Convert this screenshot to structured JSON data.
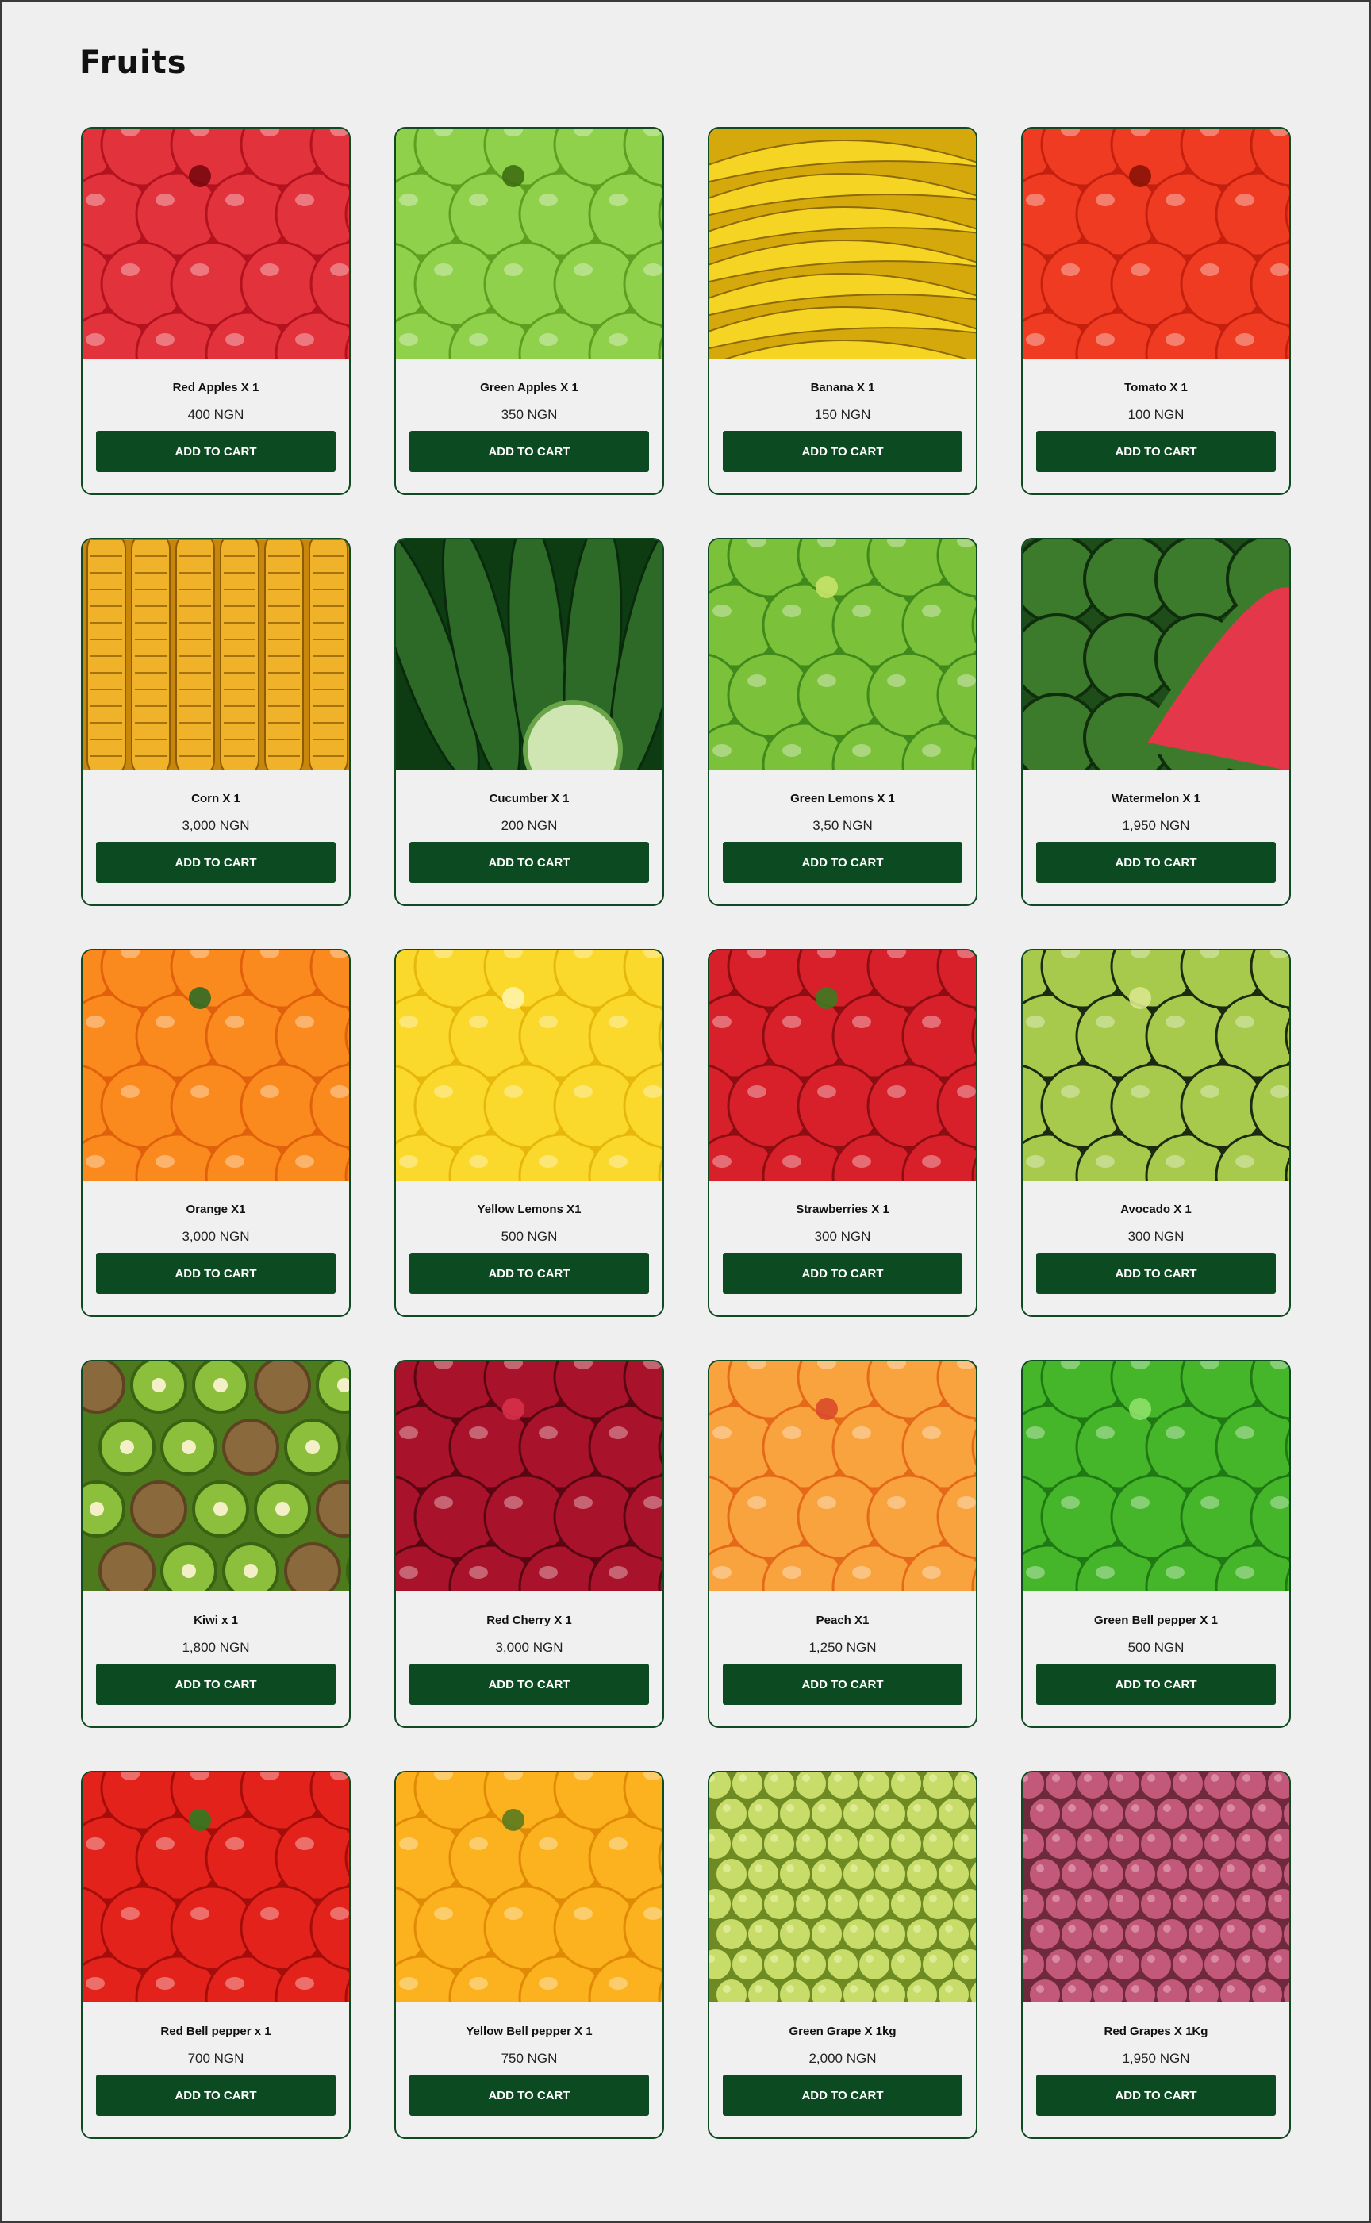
{
  "page": {
    "title": "Fruits"
  },
  "products": [
    {
      "name": "Red Apples X 1",
      "price": "400 NGN",
      "cta": "ADD TO CART",
      "icon": "red-apples-image",
      "bg": "#b3121f",
      "fg": "#e2323c",
      "accent": "#7a0810",
      "shape": "circle"
    },
    {
      "name": "Green Apples X 1",
      "price": "350 NGN",
      "cta": "ADD TO CART",
      "icon": "green-apples-image",
      "bg": "#5e9e21",
      "fg": "#8fd14a",
      "accent": "#3e6e12",
      "shape": "circle"
    },
    {
      "name": "Banana X 1",
      "price": "150 NGN",
      "cta": "ADD TO CART",
      "icon": "banana-image",
      "bg": "#d5a90c",
      "fg": "#f6d424",
      "accent": "#8c6a08",
      "shape": "banana"
    },
    {
      "name": "Tomato X 1",
      "price": "100 NGN",
      "cta": "ADD TO CART",
      "icon": "tomato-image",
      "bg": "#c5200f",
      "fg": "#ee3b22",
      "accent": "#8a1407",
      "shape": "circle"
    },
    {
      "name": "Corn X 1",
      "price": "3,000 NGN",
      "cta": "ADD TO CART",
      "icon": "corn-image",
      "bg": "#c8860b",
      "fg": "#f0b228",
      "accent": "#8e5c05",
      "shape": "corn"
    },
    {
      "name": "Cucumber X 1",
      "price": "200 NGN",
      "cta": "ADD TO CART",
      "icon": "cucumber-image",
      "bg": "#0d3b12",
      "fg": "#2d6a27",
      "accent": "#cfe6b3",
      "shape": "cucumber"
    },
    {
      "name": "Green Lemons X 1",
      "price": "3,50 NGN",
      "cta": "ADD TO CART",
      "icon": "green-lemons-image",
      "bg": "#3f8a1b",
      "fg": "#7cc13a",
      "accent": "#c8e36a",
      "shape": "circle"
    },
    {
      "name": "Watermelon X 1",
      "price": "1,950 NGN",
      "cta": "ADD TO CART",
      "icon": "watermelon-image",
      "bg": "#1f4d1a",
      "fg": "#3c7a2c",
      "accent": "#e4384a",
      "shape": "watermelon"
    },
    {
      "name": "Orange X1",
      "price": "3,000 NGN",
      "cta": "ADD TO CART",
      "icon": "orange-image",
      "bg": "#e0600c",
      "fg": "#fb8a1e",
      "accent": "#2f6a24",
      "shape": "circle"
    },
    {
      "name": "Yellow Lemons X1",
      "price": "500 NGN",
      "cta": "ADD TO CART",
      "icon": "yellow-lemons-image",
      "bg": "#e6b80c",
      "fg": "#fbd92c",
      "accent": "#fff3a8",
      "shape": "circle"
    },
    {
      "name": "Strawberries X 1",
      "price": "300 NGN",
      "cta": "ADD TO CART",
      "icon": "strawberries-image",
      "bg": "#8e0d12",
      "fg": "#d8202b",
      "accent": "#3d7a1f",
      "shape": "circle"
    },
    {
      "name": "Avocado X 1",
      "price": "300 NGN",
      "cta": "ADD TO CART",
      "icon": "avocado-image",
      "bg": "#1c2a12",
      "fg": "#a7c94c",
      "accent": "#d9e58c",
      "shape": "circle"
    },
    {
      "name": "Kiwi x 1",
      "price": "1,800 NGN",
      "cta": "ADD TO CART",
      "icon": "kiwi-image",
      "bg": "#4d7a1c",
      "fg": "#8cbf3b",
      "accent": "#8a6a3c",
      "shape": "kiwi"
    },
    {
      "name": "Red Cherry X 1",
      "price": "3,000 NGN",
      "cta": "ADD TO CART",
      "icon": "red-cherry-image",
      "bg": "#5a0612",
      "fg": "#a8122a",
      "accent": "#d6304a",
      "shape": "circle"
    },
    {
      "name": "Peach X1",
      "price": "1,250 NGN",
      "cta": "ADD TO CART",
      "icon": "peach-image",
      "bg": "#e46a1a",
      "fg": "#f9a33e",
      "accent": "#d84a2a",
      "shape": "circle"
    },
    {
      "name": "Green Bell pepper X 1",
      "price": "500 NGN",
      "cta": "ADD TO CART",
      "icon": "green-bell-pepper-image",
      "bg": "#1f7a14",
      "fg": "#45b52a",
      "accent": "#8ee06a",
      "shape": "circle"
    },
    {
      "name": "Red Bell pepper x 1",
      "price": "700 NGN",
      "cta": "ADD TO CART",
      "icon": "red-bell-pepper-image",
      "bg": "#a50d0a",
      "fg": "#e4221c",
      "accent": "#2e7a1f",
      "shape": "circle"
    },
    {
      "name": "Yellow Bell pepper X 1",
      "price": "750 NGN",
      "cta": "ADD TO CART",
      "icon": "yellow-bell-pepper-image",
      "bg": "#e08a06",
      "fg": "#fbb21e",
      "accent": "#5a7a1f",
      "shape": "circle"
    },
    {
      "name": "Green Grape X 1kg",
      "price": "2,000 NGN",
      "cta": "ADD TO CART",
      "icon": "green-grape-image",
      "bg": "#6e8a22",
      "fg": "#c8dc6a",
      "accent": "#e8f0a8",
      "shape": "grape"
    },
    {
      "name": "Red Grapes  X 1Kg",
      "price": "1,950 NGN",
      "cta": "ADD TO CART",
      "icon": "red-grapes-image",
      "bg": "#6e2a3c",
      "fg": "#c2587a",
      "accent": "#e6a0b8",
      "shape": "grape"
    }
  ]
}
